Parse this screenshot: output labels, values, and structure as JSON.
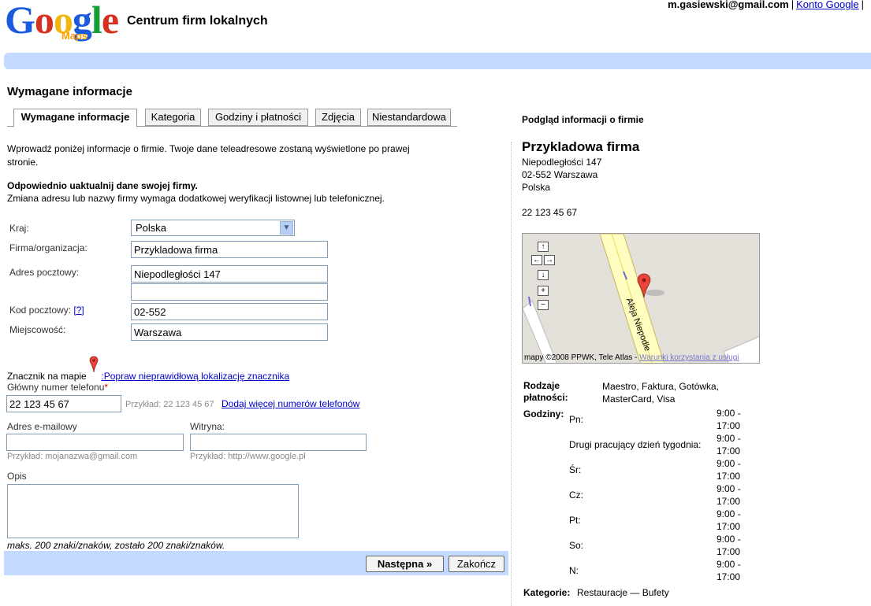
{
  "header": {
    "logo_text": "Google",
    "logo_sub": "Maps",
    "app_title": "Centrum firm lokalnych",
    "user_email": "m.gasiewski@gmail.com",
    "account_link": "Konto Google",
    "bar_color": "#c3d9ff"
  },
  "page_title": "Wymagane informacje",
  "tabs": [
    {
      "label": "Wymagane informacje",
      "active": true
    },
    {
      "label": "Kategoria",
      "active": false
    },
    {
      "label": "Godziny i płatności",
      "active": false
    },
    {
      "label": "Zdjęcia",
      "active": false
    },
    {
      "label": "Niestandardowa",
      "active": false
    }
  ],
  "intro": "Wprowadź poniżej informacje o firmie. Twoje dane teleadresowe zostaną wyświetlone po prawej stronie.",
  "notice": {
    "title": "Odpowiednio uaktualnij dane swojej firmy.",
    "text": "Zmiana adresu lub nazwy firmy wymaga dodatkowej weryfikacji listownej lub telefonicznej."
  },
  "form": {
    "country_label": "Kraj:",
    "country_value": "Polska",
    "company_label": "Firma/organizacja:",
    "company_value": "Przykladowa firma",
    "address_label": "Adres pocztowy:",
    "address_value": "Niepodległości 147",
    "address2_value": "",
    "postal_label": "Kod pocztowy:",
    "postal_help": "[?]",
    "postal_value": "02-552",
    "city_label": "Miejscowość:",
    "city_value": "Warszawa",
    "marker_label": "Znacznik na mapie",
    "marker_link": ":Popraw nieprawidłową lokalizację znacznika",
    "phone_label": "Główny numer telefonu",
    "phone_required": "*",
    "phone_value": "22 123 45 67",
    "phone_example": "Przykład: 22 123 45 67",
    "add_phone_link": "Dodaj więcej numerów telefonów",
    "email_label": "Adres e-mailowy",
    "email_value": "",
    "email_example": "Przykład: mojanazwa@gmail.com",
    "website_label": "Witryna:",
    "website_value": "",
    "website_example": "Przykład: http://www.google.pl",
    "desc_label": "Opis",
    "desc_value": "",
    "desc_counter": "maks. 200 znaki/znaków, zostało 200 znaki/znaków."
  },
  "buttons": {
    "next": "Następna »",
    "finish": "Zakończ"
  },
  "preview": {
    "heading": "Podgląd informacji o firmie",
    "name": "Przykladowa firma",
    "street": "Niepodległości 147",
    "postal_city": "02-552 Warszawa",
    "country": "Polska",
    "phone": "22 123 45 67",
    "map_street_label": "Aleja Niepodle",
    "map_copyright": "mapy ©2008 PPWK, Tele Atlas - ",
    "map_terms_link": "Warunki korzystania z usługi",
    "payment_label_1": "Rodzaje",
    "payment_label_2": "płatności:",
    "payment_value": "Maestro, Faktura, Gotówka, MasterCard, Visa",
    "hours_label": "Godziny:",
    "hours": [
      {
        "day": "Pn:",
        "open": "9:00 -",
        "close": "17:00"
      },
      {
        "day": "Drugi pracujący dzień tygodnia:",
        "open": "9:00 -",
        "close": "17:00"
      },
      {
        "day": "Śr:",
        "open": "9:00 -",
        "close": "17:00"
      },
      {
        "day": "Cz:",
        "open": "9:00 -",
        "close": "17:00"
      },
      {
        "day": "Pt:",
        "open": "9:00 -",
        "close": "17:00"
      },
      {
        "day": "So:",
        "open": "9:00 -",
        "close": "17:00"
      },
      {
        "day": "N:",
        "open": "9:00 -",
        "close": "17:00"
      }
    ],
    "category_label": "Kategorie:",
    "category_value": "Restauracje — Bufety"
  },
  "icons": [
    "pan-up-icon",
    "pan-left-icon",
    "pan-right-icon",
    "pan-down-icon",
    "zoom-in-icon",
    "zoom-out-icon",
    "map-marker-icon",
    "dropdown-arrow-icon"
  ]
}
